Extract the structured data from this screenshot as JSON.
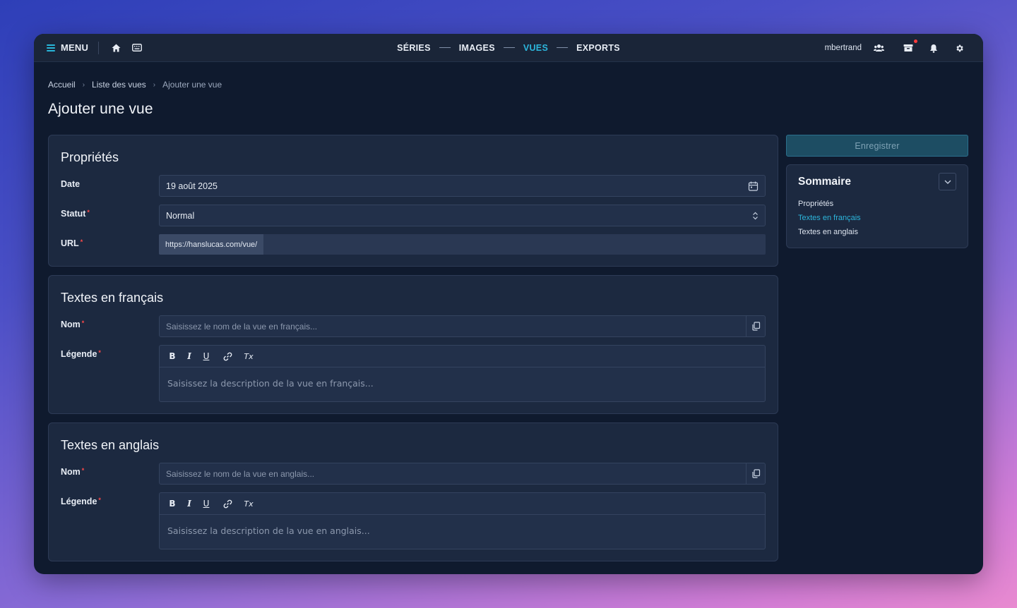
{
  "topbar": {
    "menu_label": "MENU",
    "nav": [
      {
        "label": "SÉRIES",
        "active": false
      },
      {
        "label": "IMAGES",
        "active": false
      },
      {
        "label": "VUES",
        "active": true
      },
      {
        "label": "EXPORTS",
        "active": false
      }
    ],
    "username": "mbertrand",
    "icons": [
      "hamburger-icon",
      "home-icon",
      "keyboard-icon",
      "users-icon",
      "inbox-icon",
      "bell-icon",
      "gear-icon"
    ],
    "accent_color": "#2cb6dc"
  },
  "breadcrumb": {
    "items": [
      "Accueil",
      "Liste des vues",
      "Ajouter une vue"
    ]
  },
  "page_title": "Ajouter une vue",
  "properties": {
    "title": "Propriétés",
    "date_label": "Date",
    "date_value": "19 août 2025",
    "status_label": "Statut",
    "status_value": "Normal",
    "url_label": "URL",
    "url_prefix": "https://hanslucas.com/vue/",
    "url_value": ""
  },
  "fr_texts": {
    "title": "Textes en français",
    "name_label": "Nom",
    "name_placeholder": "Saisissez le nom de la vue en français...",
    "caption_label": "Légende",
    "caption_placeholder": "Saisissez la description de la vue en français..."
  },
  "en_texts": {
    "title": "Textes en anglais",
    "name_label": "Nom",
    "name_placeholder": "Saisissez le nom de la vue en anglais...",
    "caption_label": "Légende",
    "caption_placeholder": "Saisissez la description de la vue en anglais..."
  },
  "editor_toolbar": {
    "bold": "B",
    "italic": "I",
    "underline": "U",
    "clear": "Tx"
  },
  "sidebar": {
    "save_label": "Enregistrer",
    "summary_title": "Sommaire",
    "summary_items": [
      {
        "label": "Propriétés",
        "active": false
      },
      {
        "label": "Textes en français",
        "active": true
      },
      {
        "label": "Textes en anglais",
        "active": false
      }
    ]
  }
}
